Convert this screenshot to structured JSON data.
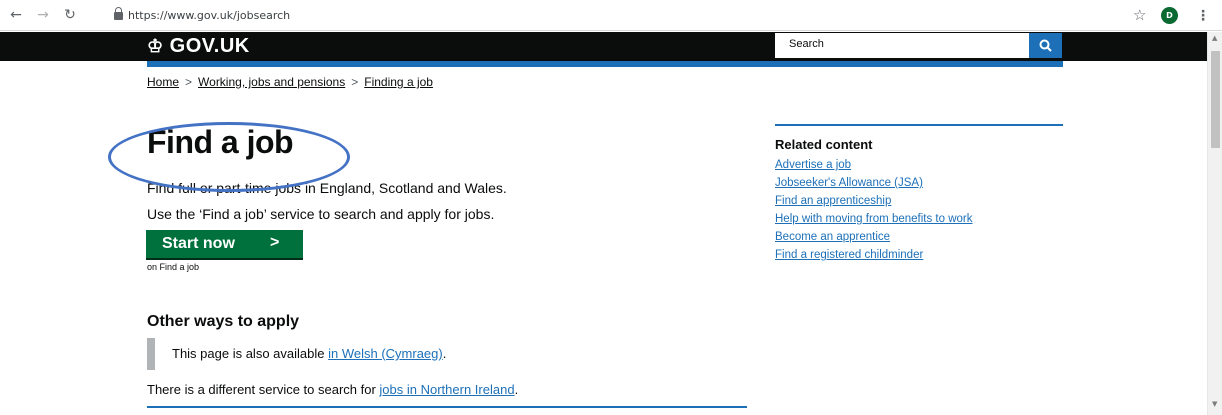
{
  "browser": {
    "url": "https://www.gov.uk/jobsearch",
    "profile_initial": "D"
  },
  "header": {
    "logo_text": "GOV.UK",
    "search_placeholder": "Search"
  },
  "breadcrumb": {
    "items": [
      "Home",
      "Working, jobs and pensions",
      "Finding a job"
    ],
    "separator": ">"
  },
  "main": {
    "title": "Find a job",
    "lead": "Find full or part-time jobs in England, Scotland and Wales.",
    "instruction": "Use the ‘Find a job’ service to search and apply for jobs.",
    "start_button": "Start now",
    "start_button_arrow": ">",
    "start_button_context": "on Find a job",
    "other_ways_heading": "Other ways to apply",
    "welsh_text": "This page is also available ",
    "welsh_link": "in Welsh (Cymraeg)",
    "welsh_suffix": ".",
    "ni_text": "There is a different service to search for ",
    "ni_link": "jobs in Northern Ireland",
    "ni_suffix": "."
  },
  "related": {
    "heading": "Related content",
    "links": [
      "Advertise a job",
      "Jobseeker's Allowance (JSA)",
      "Find an apprenticeship",
      "Help with moving from benefits to work",
      "Become an apprentice",
      "Find a registered childminder"
    ]
  },
  "colors": {
    "header_bg": "#0b0c0c",
    "accent_blue": "#1d70b8",
    "button_green": "#00703c",
    "annotation_ellipse": "#4472c4"
  }
}
